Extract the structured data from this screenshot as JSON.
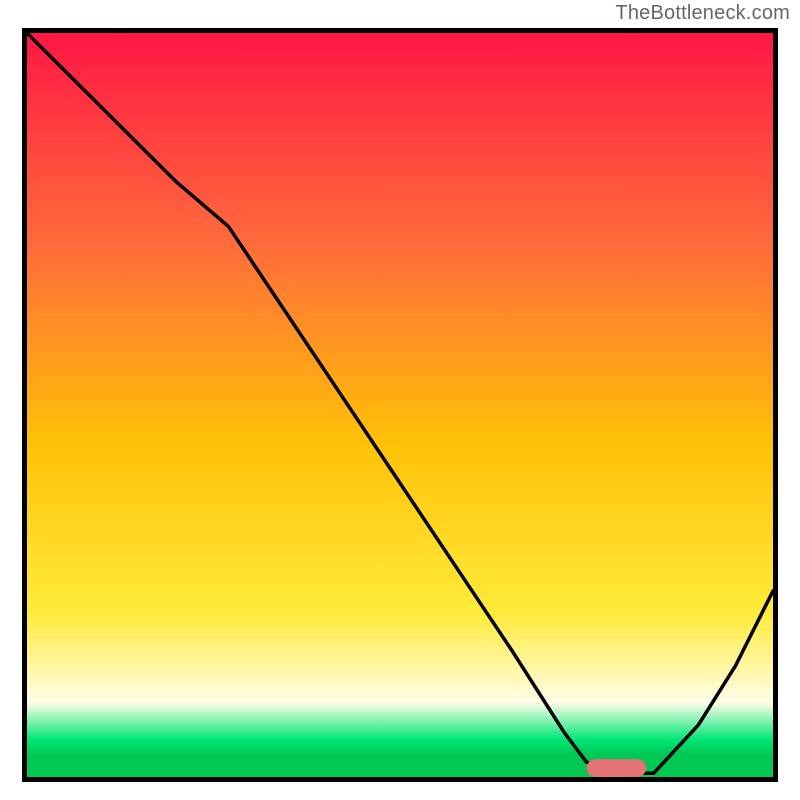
{
  "watermark": "TheBottleneck.com",
  "colors": {
    "gradient_top": "#FF1744",
    "gradient_mid_upper": "#FF6A3C",
    "gradient_mid": "#FFC107",
    "gradient_mid_lower": "#FFEB3B",
    "gradient_pale": "#FFFDE7",
    "gradient_band_green": "#00E676",
    "gradient_bottom": "#00C853",
    "curve": "#000000",
    "marker": "#E57373"
  },
  "chart_data": {
    "type": "line",
    "title": "",
    "xlabel": "",
    "ylabel": "",
    "xlim": [
      0,
      100
    ],
    "ylim": [
      0,
      100
    ],
    "grid": false,
    "legend": false,
    "series": [
      {
        "name": "bottleneck-curve",
        "x": [
          0,
          5,
          10,
          15,
          20,
          27,
          35,
          45,
          55,
          65,
          72,
          75,
          80,
          84,
          90,
          95,
          100
        ],
        "y": [
          100,
          95,
          90,
          85,
          80,
          74,
          62,
          47,
          32,
          17,
          6,
          2,
          0.5,
          0.5,
          7,
          15,
          25
        ]
      }
    ],
    "annotations": [
      {
        "name": "optimal-marker",
        "shape": "rounded-bar",
        "x_center": 79,
        "y_center": 1.2,
        "width": 8,
        "height": 2.4,
        "color": "#E57373"
      }
    ]
  }
}
